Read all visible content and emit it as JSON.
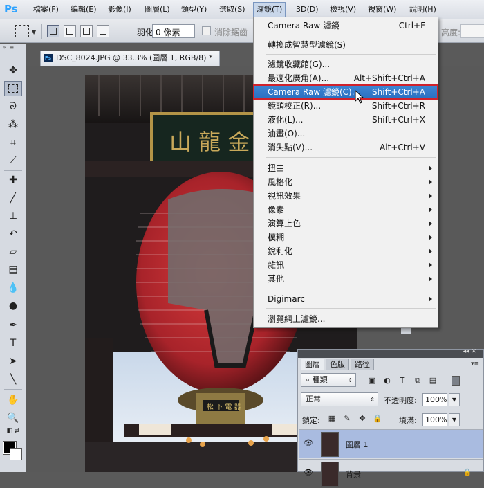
{
  "app": {
    "logo": "Ps"
  },
  "menubar": {
    "items": [
      "檔案(F)",
      "編輯(E)",
      "影像(I)",
      "圖層(L)",
      "類型(Y)",
      "選取(S)",
      "濾鏡(T)",
      "3D(D)",
      "檢視(V)",
      "視窗(W)",
      "說明(H)"
    ],
    "active_index": 6
  },
  "options": {
    "feather_label": "羽化:",
    "feather_value": "0 像素",
    "antialias_label": "消除鋸齒",
    "height_label": "高度:"
  },
  "document": {
    "tab_title": "DSC_8024.JPG @ 33.3% (圖層 1, RGB/8) *",
    "tab_icon": "Ps"
  },
  "filter_menu": {
    "items": [
      {
        "label": "Camera Raw 濾鏡",
        "shortcut": "Ctrl+F"
      },
      {
        "label": "轉換成智慧型濾鏡(S)",
        "shortcut": ""
      },
      {
        "label": "濾鏡收藏館(G)...",
        "shortcut": ""
      },
      {
        "label": "最適化廣角(A)...",
        "shortcut": "Alt+Shift+Ctrl+A"
      },
      {
        "label": "Camera Raw 濾鏡(C)...",
        "shortcut": "Shift+Ctrl+A",
        "highlighted": true
      },
      {
        "label": "鏡頭校正(R)...",
        "shortcut": "Shift+Ctrl+R"
      },
      {
        "label": "液化(L)...",
        "shortcut": "Shift+Ctrl+X"
      },
      {
        "label": "油畫(O)...",
        "shortcut": ""
      },
      {
        "label": "消失點(V)...",
        "shortcut": "Alt+Ctrl+V"
      },
      {
        "label": "扭曲",
        "submenu": true
      },
      {
        "label": "風格化",
        "submenu": true
      },
      {
        "label": "視訊效果",
        "submenu": true
      },
      {
        "label": "像素",
        "submenu": true
      },
      {
        "label": "演算上色",
        "submenu": true
      },
      {
        "label": "模糊",
        "submenu": true
      },
      {
        "label": "銳利化",
        "submenu": true
      },
      {
        "label": "雜訊",
        "submenu": true
      },
      {
        "label": "其他",
        "submenu": true
      },
      {
        "label": "Digimarc",
        "submenu": true
      },
      {
        "label": "瀏覽網上濾鏡...",
        "shortcut": ""
      }
    ]
  },
  "layers_panel": {
    "tabs": [
      "圖層",
      "色版",
      "路徑"
    ],
    "active_tab": 0,
    "kind_filter": "種類",
    "blend_mode": "正常",
    "opacity_label": "不透明度:",
    "opacity_value": "100%",
    "lock_label": "鎖定:",
    "fill_label": "填滿:",
    "fill_value": "100%",
    "layers": [
      {
        "name": "圖層 1",
        "selected": true,
        "visible": true
      },
      {
        "name": "背景",
        "selected": false,
        "visible": true,
        "locked": true
      }
    ]
  },
  "colors": {
    "accent": "#2a6fc0",
    "highlight_outline": "#d0212b",
    "menu_bg": "#f1f1f1",
    "lantern_red": "#b8272c"
  }
}
